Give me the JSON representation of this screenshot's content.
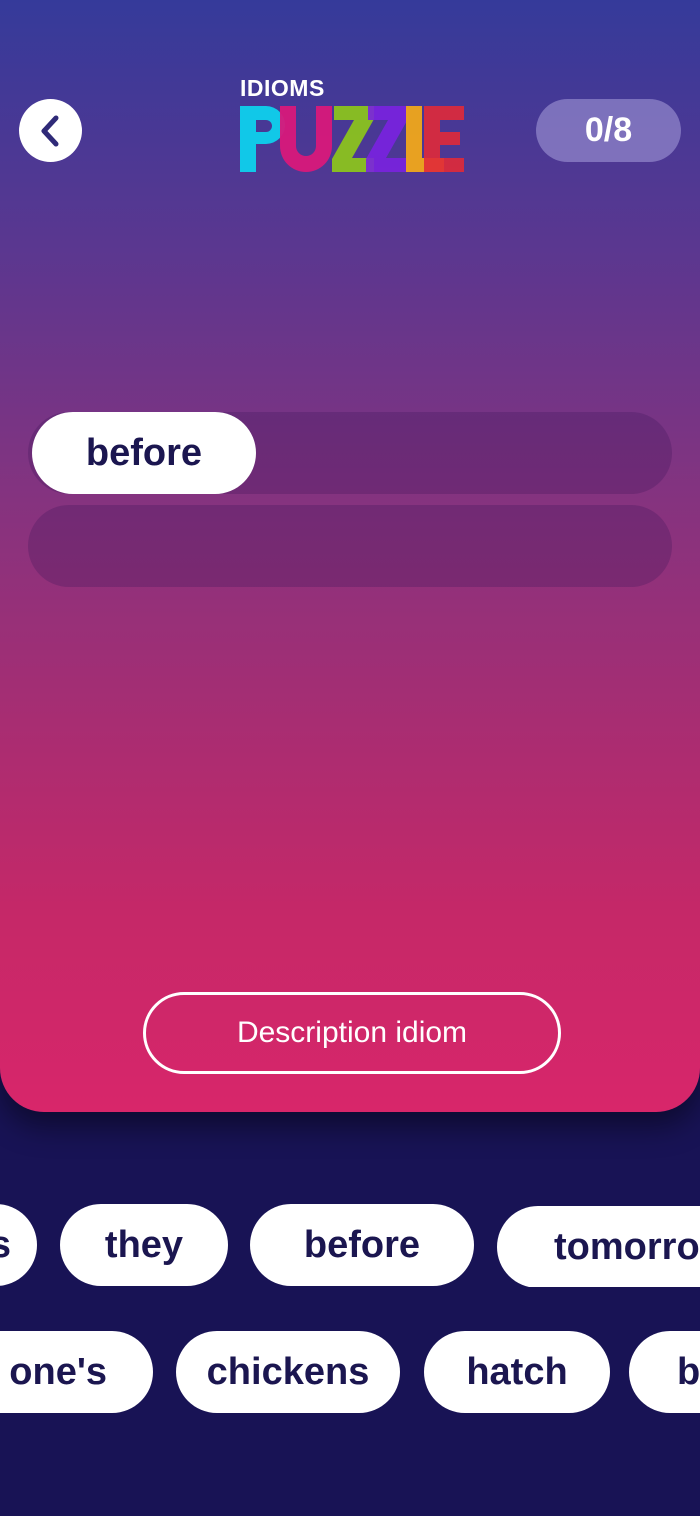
{
  "header": {
    "logo_small": "IDIOMS",
    "logo_large": "PUZZLE",
    "progress": "0/8"
  },
  "answer": {
    "placed_words": [
      "before"
    ]
  },
  "description_button": "Description idiom",
  "word_bank": {
    "row1": [
      "s",
      "they",
      "before",
      "tomorro"
    ],
    "row2": [
      "one's",
      "chickens",
      "hatch",
      "b"
    ]
  },
  "colors": {
    "accent_text": "#1b1650",
    "background": "#181355",
    "gradient_top": "#353a9a",
    "gradient_bottom": "#d8266a"
  },
  "icons": [
    "back-arrow-icon"
  ]
}
